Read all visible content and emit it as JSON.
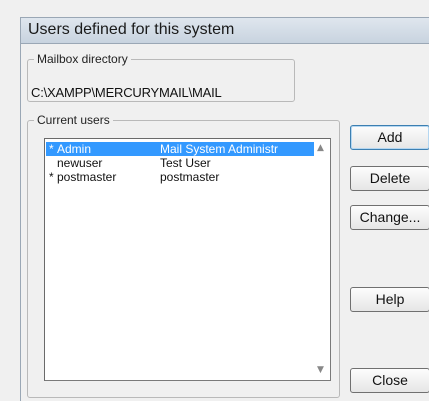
{
  "window": {
    "title": "Users defined for this system"
  },
  "mailbox": {
    "label": "Mailbox directory",
    "path": "C:\\XAMPP\\MERCURYMAIL\\MAIL"
  },
  "users": {
    "label": "Current users",
    "rows": [
      {
        "mark": "*",
        "name": "Admin",
        "description": "Mail System Administr",
        "selected": true
      },
      {
        "mark": "",
        "name": "newuser",
        "description": "Test User",
        "selected": false
      },
      {
        "mark": "*",
        "name": "postmaster",
        "description": "postmaster",
        "selected": false
      }
    ]
  },
  "buttons": {
    "add": "Add",
    "delete": "Delete",
    "change": "Change...",
    "help": "Help",
    "close": "Close"
  },
  "icons": {
    "scroll_up": "scroll-up-arrow",
    "scroll_down": "scroll-down-arrow"
  },
  "colors": {
    "selection": "#3399ff",
    "title_bar": "#c8d3df"
  }
}
